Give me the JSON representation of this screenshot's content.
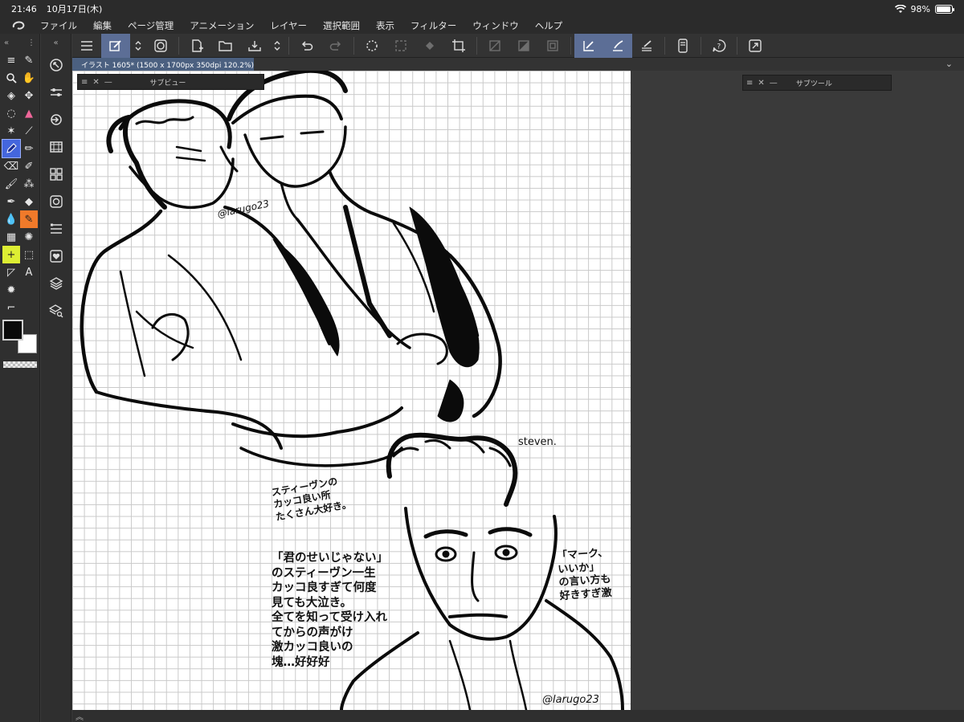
{
  "status": {
    "time": "21:46",
    "date": "10月17日(木)",
    "battery": "98%"
  },
  "menu": {
    "items": [
      "ファイル",
      "編集",
      "ページ管理",
      "アニメーション",
      "レイヤー",
      "選択範囲",
      "表示",
      "フィルター",
      "ウィンドウ",
      "ヘルプ"
    ]
  },
  "document": {
    "tab_title": "イラスト 1605* (1500 x 1700px 350dpi 120.2%)"
  },
  "palettes": {
    "subview_title": "サブビュー",
    "subtool_title": "サブツール"
  },
  "artwork": {
    "signature_top": "@larugo23",
    "signature_bottom": "@larugo23",
    "label_steven": "steven.",
    "note_1": "スティーヴンの\nカッコ良い所\nたくさん大好き。",
    "note_2": "「君のせいじゃない」\nのスティーヴン一生\nカッコ良すぎて何度\n見ても大泣き。\n全てを知って受け入れ\nてからの声がけ\n激カッコ良いの\n塊…好好好",
    "note_3": "「マーク、\nいいか」\nの言い方も\n好きすぎ激"
  },
  "colors": {
    "foreground": "#0a0a0a",
    "background": "#ffffff",
    "accent_active": "#4466dd",
    "accent_orange": "#f07a2a",
    "accent_yellow": "#ddee33",
    "selected_cmd": "#5c6e96"
  }
}
